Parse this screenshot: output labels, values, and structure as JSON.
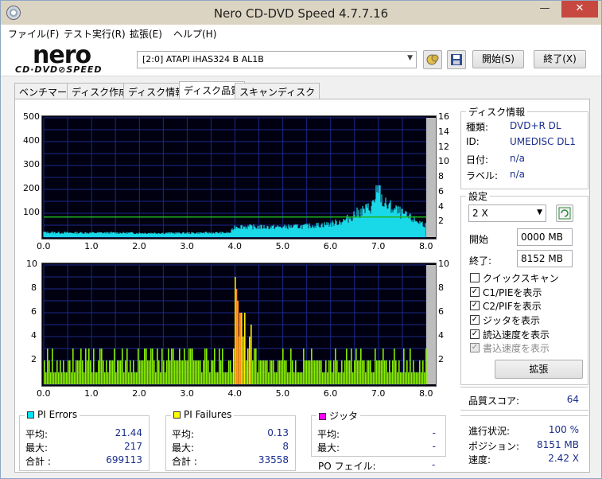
{
  "window": {
    "title": "Nero CD-DVD Speed 4.7.7.16",
    "min_glyph": "—",
    "max_glyph": "☐",
    "close_glyph": "✕"
  },
  "menu": [
    "ファイル(F)",
    "テスト実行(R)",
    "拡張(E)",
    "ヘルプ(H)"
  ],
  "toolbar": {
    "logo_top": "nero",
    "logo_bottom": "CD·DVD⊘SPEED",
    "drive": "[2:0]   ATAPI iHAS324   B AL1B",
    "start_button": "開始(S)",
    "exit_button": "終了(X)"
  },
  "tabs": [
    "ベンチマーク",
    "ディスク作成",
    "ディスク情報",
    "ディスク品質",
    "スキャンディスク"
  ],
  "active_tab": 3,
  "disc_info": {
    "title": "ディスク情報",
    "type_label": "種類:",
    "type_value": "DVD+R DL",
    "id_label": "ID:",
    "id_value": "UMEDISC DL1",
    "date_label": "日付:",
    "date_value": "n/a",
    "label_label": "ラベル:",
    "label_value": "n/a"
  },
  "settings": {
    "title": "設定",
    "speed": "2 X",
    "start_label": "開始",
    "start_value": "0000 MB",
    "end_label": "終了:",
    "end_value": "8152 MB",
    "checks": [
      {
        "label": "クイックスキャン",
        "checked": false
      },
      {
        "label": "C1/PIEを表示",
        "checked": true
      },
      {
        "label": "C2/PIFを表示",
        "checked": true
      },
      {
        "label": "ジッタを表示",
        "checked": true
      },
      {
        "label": "読込速度を表示",
        "checked": true
      },
      {
        "label": "書込速度を表示",
        "checked": true,
        "disabled": true
      }
    ],
    "expand_button": "拡張"
  },
  "quality": {
    "label": "品質スコア:",
    "value": "64"
  },
  "progress": {
    "status_label": "進行状況:",
    "status_value": "100 %",
    "position_label": "ポジション:",
    "position_value": "8151 MB",
    "speed_label": "速度:",
    "speed_value": "2.42 X"
  },
  "pi_errors": {
    "title": "PI Errors",
    "color": "#00e5ff",
    "avg_label": "平均:",
    "avg": "21.44",
    "max_label": "最大:",
    "max": "217",
    "total_label": "合計 :",
    "total": "699113"
  },
  "pi_failures": {
    "title": "PI Failures",
    "color": "#ffff00",
    "avg_label": "平均:",
    "avg": "0.13",
    "max_label": "最大:",
    "max": "8",
    "total_label": "合計 :",
    "total": "33558"
  },
  "jitter": {
    "title": "ジッタ",
    "color": "#ff00ff",
    "avg_label": "平均:",
    "avg": "-",
    "max_label": "最大:",
    "max": "-",
    "po_label": "PO フェイル:",
    "po": "-"
  },
  "chart_data": [
    {
      "type": "area",
      "x_ticks": [
        "0.0",
        "1.0",
        "2.0",
        "3.0",
        "4.0",
        "5.0",
        "6.0",
        "7.0",
        "8.0"
      ],
      "y_left_ticks": [
        "500",
        "400",
        "300",
        "200",
        "100"
      ],
      "y_right_ticks": [
        "16",
        "14",
        "12",
        "10",
        "8",
        "6",
        "4",
        "2"
      ],
      "xlim": [
        0,
        8
      ],
      "ylim": [
        0,
        500
      ],
      "y2lim": [
        0,
        16
      ],
      "series": [
        {
          "values_x": [
            0.0,
            0.5,
            1.0,
            1.5,
            2.0,
            2.5,
            3.0,
            3.5,
            3.9,
            4.0,
            4.5,
            5.0,
            5.5,
            6.0,
            6.3,
            6.5,
            6.8,
            6.95,
            7.0,
            7.1,
            7.3,
            7.6,
            8.0
          ],
          "values_y": [
            20,
            18,
            18,
            18,
            17,
            17,
            17,
            18,
            18,
            45,
            42,
            42,
            46,
            55,
            70,
            95,
            120,
            150,
            217,
            140,
            120,
            85,
            50
          ]
        },
        {
          "values_x": [
            0.0,
            8.0
          ],
          "values_y": [
            2.7,
            2.7
          ]
        }
      ],
      "grid": true
    },
    {
      "type": "bar",
      "x_ticks": [
        "0.0",
        "1.0",
        "2.0",
        "3.0",
        "4.0",
        "5.0",
        "6.0",
        "7.0",
        "8.0"
      ],
      "y_left_ticks": [
        "10",
        "8",
        "6",
        "4",
        "2"
      ],
      "y_right_ticks": [
        "10",
        "8",
        "6",
        "4",
        "2"
      ],
      "xlim": [
        0,
        8
      ],
      "ylim": [
        0,
        10
      ],
      "series": [
        {
          "values_x": [
            0.0,
            1.0,
            2.0,
            3.0,
            3.9,
            4.0,
            4.1,
            4.3,
            5.0,
            6.0,
            7.0,
            8.0
          ],
          "values_y": [
            2,
            2,
            2,
            2,
            3,
            8,
            6,
            4,
            2,
            2,
            2,
            2
          ]
        }
      ],
      "grid": true
    }
  ]
}
